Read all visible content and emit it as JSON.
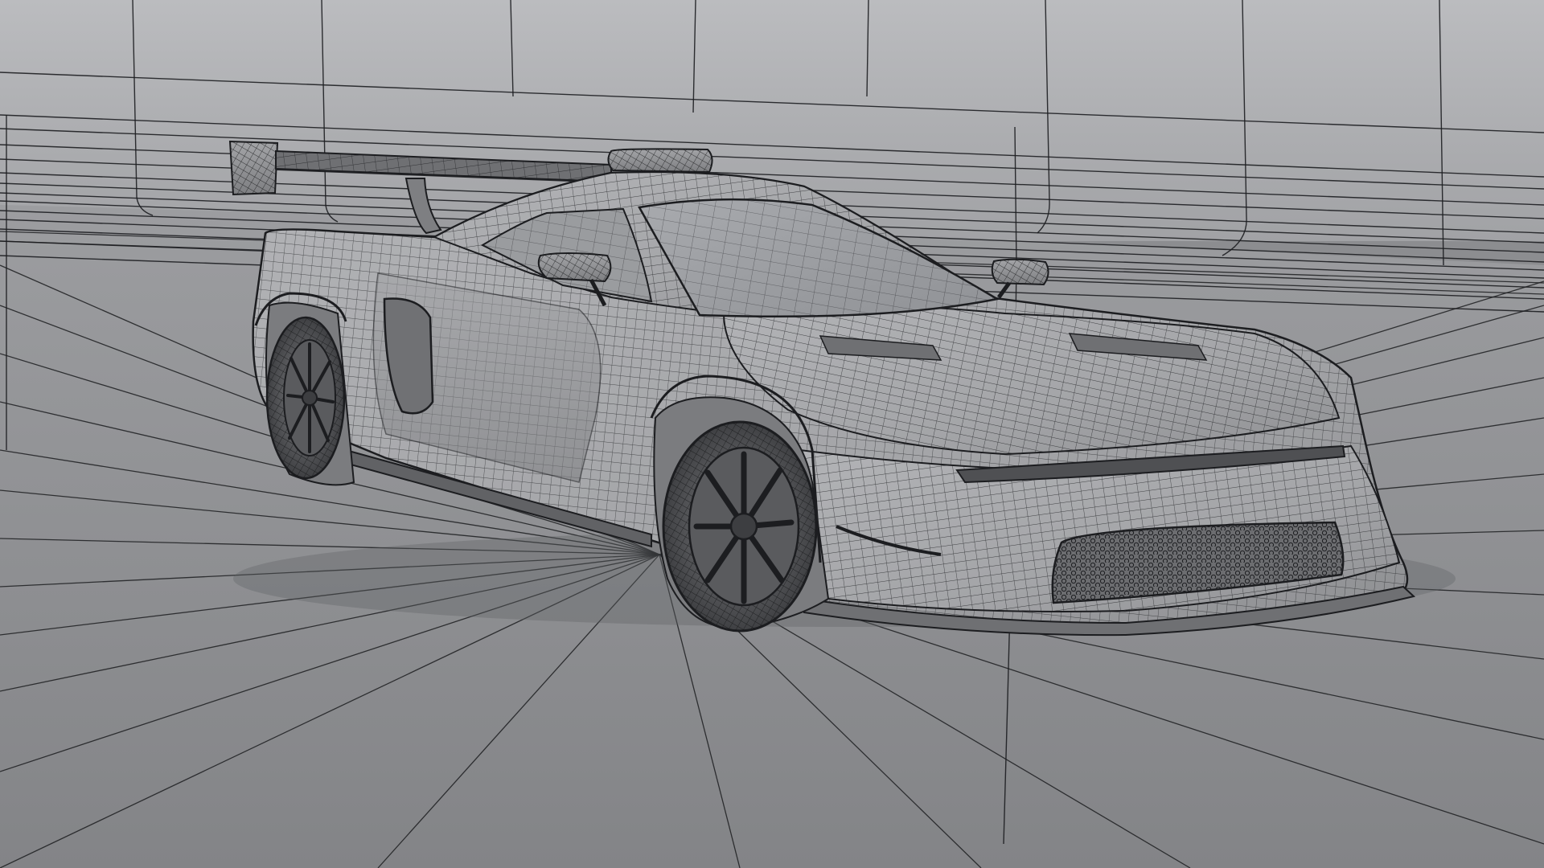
{
  "scene": {
    "subject": "race-car-wireframe-model",
    "colors": {
      "backdrop_top": "#b9babd",
      "backdrop_bottom": "#a3a4a7",
      "floor": "#888a8d",
      "floor_far": "#9a9b9e",
      "body": "#a9aaad",
      "body_shade": "#8e8f92",
      "body_dark": "#6f7073",
      "tire": "#4a4b4e",
      "rim": "#58595c",
      "glass": "#9ea0a4",
      "grille": "#6a6b6e",
      "wire": "#1c1d20"
    }
  }
}
